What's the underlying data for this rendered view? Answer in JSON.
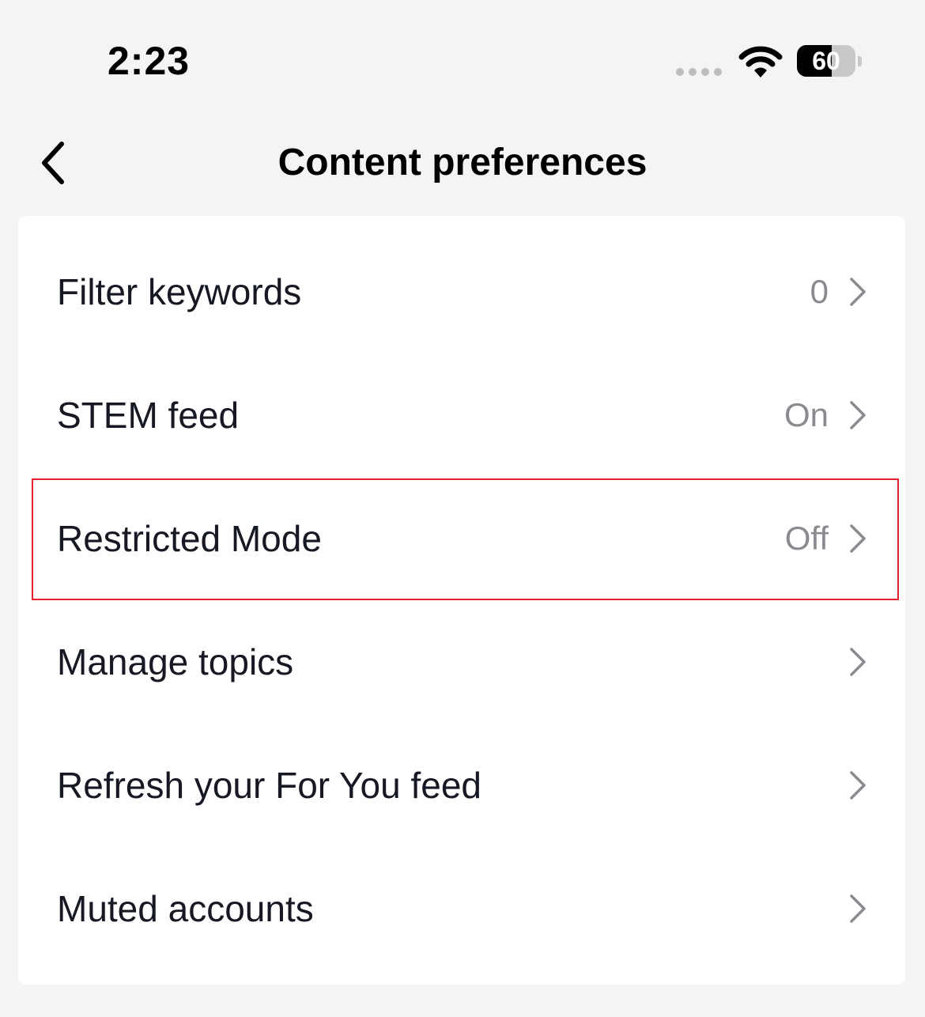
{
  "status_bar": {
    "time": "2:23",
    "battery_level": "60",
    "battery_fraction": 0.6
  },
  "header": {
    "title": "Content preferences",
    "back_icon": "chevron-left-icon"
  },
  "settings": {
    "items": [
      {
        "label": "Filter keywords",
        "value": "0"
      },
      {
        "label": "STEM feed",
        "value": "On"
      },
      {
        "label": "Restricted Mode",
        "value": "Off"
      },
      {
        "label": "Manage topics",
        "value": ""
      },
      {
        "label": "Refresh your For You feed",
        "value": ""
      },
      {
        "label": "Muted accounts",
        "value": ""
      }
    ]
  },
  "colors": {
    "background": "#f4f4f4",
    "card": "#ffffff",
    "text_primary": "#161823",
    "text_secondary": "#8a8b91",
    "highlight": "#e5202e"
  }
}
